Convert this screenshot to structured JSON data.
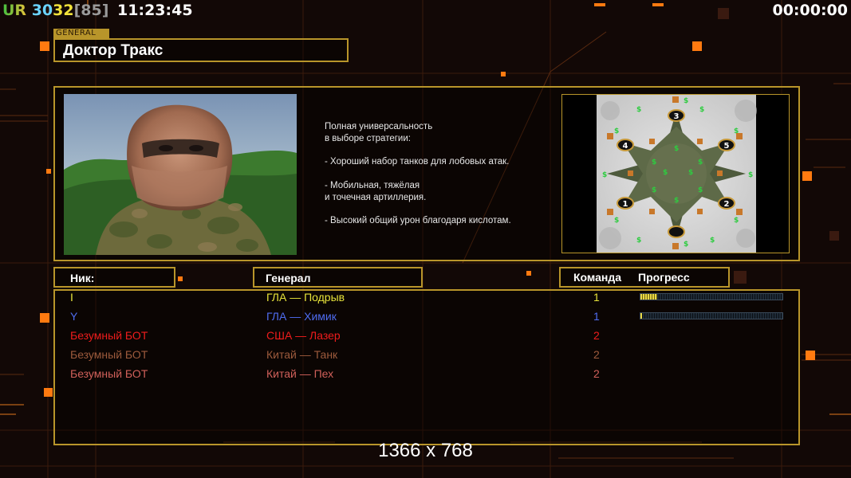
{
  "hud": {
    "ur_label": "UR",
    "ur_value_1": "30",
    "ur_value_2": "32",
    "ur_bracket": "[85]",
    "clock": "11:23:45",
    "timer": "00:00:00"
  },
  "general": {
    "section_label": "GENERAL",
    "name": "Доктор Тракс",
    "description": "Полная универсальность\nв выборе стратегии:\n\n- Хороший набор танков для лобовых атак.\n\n- Мобильная, тяжёлая\nи точечная артиллерия.\n\n- Высокий общий урон благодаря кислотам."
  },
  "map": {
    "slots": [
      "1",
      "2",
      "3",
      "4",
      "5"
    ],
    "resource_icon": "dollar-icon",
    "base_icon": "building-icon"
  },
  "table": {
    "headers": {
      "nick": "Ник:",
      "general": "Генерал",
      "team": "Команда",
      "progress": "Прогресс"
    },
    "rows": [
      {
        "nick": "I",
        "general": "ГЛА — Подрыв",
        "team": "1",
        "color": "#e6e23a",
        "progress": 0.12
      },
      {
        "nick": "Y",
        "general": "ГЛА — Химик",
        "team": "1",
        "color": "#4f6cf0",
        "progress": 0.01
      },
      {
        "nick": "Безумный БОТ",
        "general": "США — Лазер",
        "team": "2",
        "color": "#ee1c1c"
      },
      {
        "nick": "Безумный БОТ",
        "general": "Китай — Танк",
        "team": "2",
        "color": "#9c5a3c"
      },
      {
        "nick": "Безумный БОТ",
        "general": "Китай — Пех",
        "team": "2",
        "color": "#d0605a"
      }
    ]
  },
  "footer": {
    "resolution": "1366 x 768"
  },
  "colors": {
    "frame": "#b8952a",
    "accent": "#ff7a10",
    "background": "#120806"
  }
}
